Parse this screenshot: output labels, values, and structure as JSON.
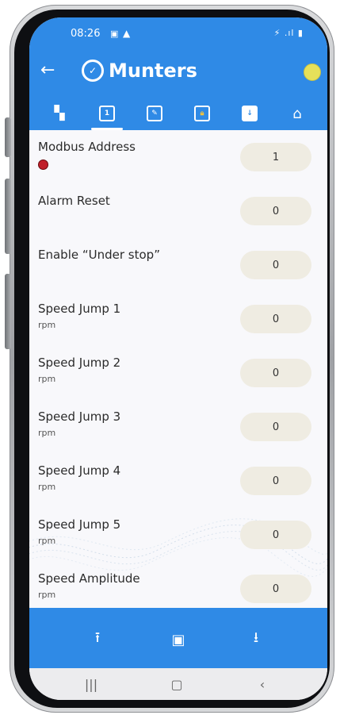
{
  "status": {
    "time": "08:26",
    "right": "⚡ .ıl ▮"
  },
  "app": {
    "brand": "Munters"
  },
  "tabs": [
    "dashboard",
    "page1",
    "edit-settings",
    "lock-settings",
    "download",
    "remote"
  ],
  "rows": [
    {
      "label": "Modbus Address",
      "unit": "",
      "value": "1",
      "locked": true
    },
    {
      "label": "Alarm Reset",
      "unit": "",
      "value": "0"
    },
    {
      "label": "Enable “Under stop”",
      "unit": "",
      "value": "0"
    },
    {
      "label": "Speed Jump 1",
      "unit": "rpm",
      "value": "0"
    },
    {
      "label": "Speed Jump 2",
      "unit": "rpm",
      "value": "0"
    },
    {
      "label": "Speed Jump 3",
      "unit": "rpm",
      "value": "0"
    },
    {
      "label": "Speed Jump 4",
      "unit": "rpm",
      "value": "0"
    },
    {
      "label": "Speed Jump 5",
      "unit": "rpm",
      "value": "0"
    },
    {
      "label": "Speed Amplitude",
      "unit": "rpm",
      "value": "0"
    }
  ],
  "colors": {
    "header": "#2f8ae6",
    "valuePill": "#efece2",
    "statusDot": "#e6e05a"
  }
}
